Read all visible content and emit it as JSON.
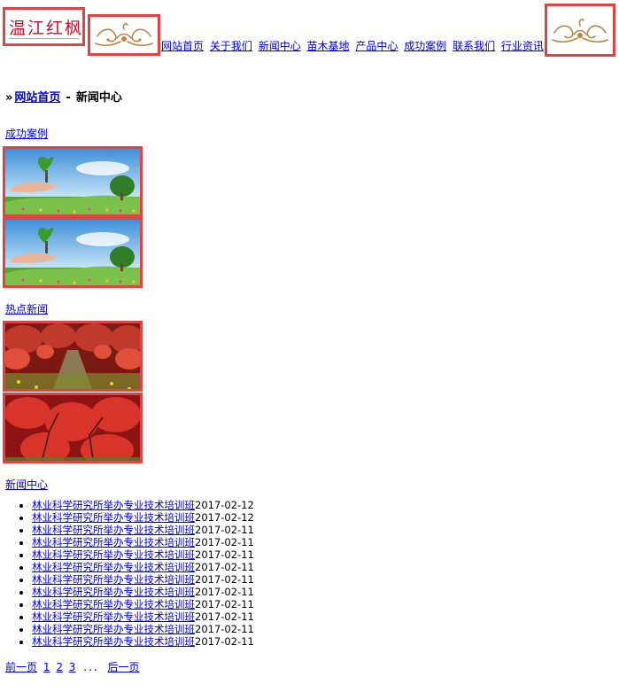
{
  "header": {
    "logo_text": "温江红枫",
    "nav": [
      "网站首页",
      "关于我们",
      "新闻中心",
      "苗木基地",
      "产品中心",
      "成功案例",
      "联系我们",
      "行业资讯"
    ]
  },
  "breadcrumb": {
    "arrow": "»",
    "home": "网站首页",
    "separator": "-",
    "current": "新闻中心"
  },
  "sections": {
    "cases_link": "成功案例",
    "hot_news_link": "热点新闻",
    "news_center_link": "新闻中心"
  },
  "news_items": [
    {
      "title": "林业科学研究所举办专业技术培训班",
      "date": "2017-02-12"
    },
    {
      "title": "林业科学研究所举办专业技术培训班",
      "date": "2017-02-12"
    },
    {
      "title": "林业科学研究所举办专业技术培训班",
      "date": "2017-02-11"
    },
    {
      "title": "林业科学研究所举办专业技术培训班",
      "date": "2017-02-11"
    },
    {
      "title": "林业科学研究所举办专业技术培训班",
      "date": "2017-02-11"
    },
    {
      "title": "林业科学研究所举办专业技术培训班",
      "date": "2017-02-11"
    },
    {
      "title": "林业科学研究所举办专业技术培训班",
      "date": "2017-02-11"
    },
    {
      "title": "林业科学研究所举办专业技术培训班",
      "date": "2017-02-11"
    },
    {
      "title": "林业科学研究所举办专业技术培训班",
      "date": "2017-02-11"
    },
    {
      "title": "林业科学研究所举办专业技术培训班",
      "date": "2017-02-11"
    },
    {
      "title": "林业科学研究所举办专业技术培训班",
      "date": "2017-02-11"
    },
    {
      "title": "林业科学研究所举办专业技术培训班",
      "date": "2017-02-11"
    }
  ],
  "pager": {
    "prev": "前一页",
    "pages": [
      "1",
      "2",
      "3"
    ],
    "ellipsis": "...",
    "next": "后一页"
  },
  "colors": {
    "highlight_border": "#e04545",
    "link": "#0000ee",
    "logo_red": "#c8102e",
    "ornament_gold": "#b8864b"
  }
}
